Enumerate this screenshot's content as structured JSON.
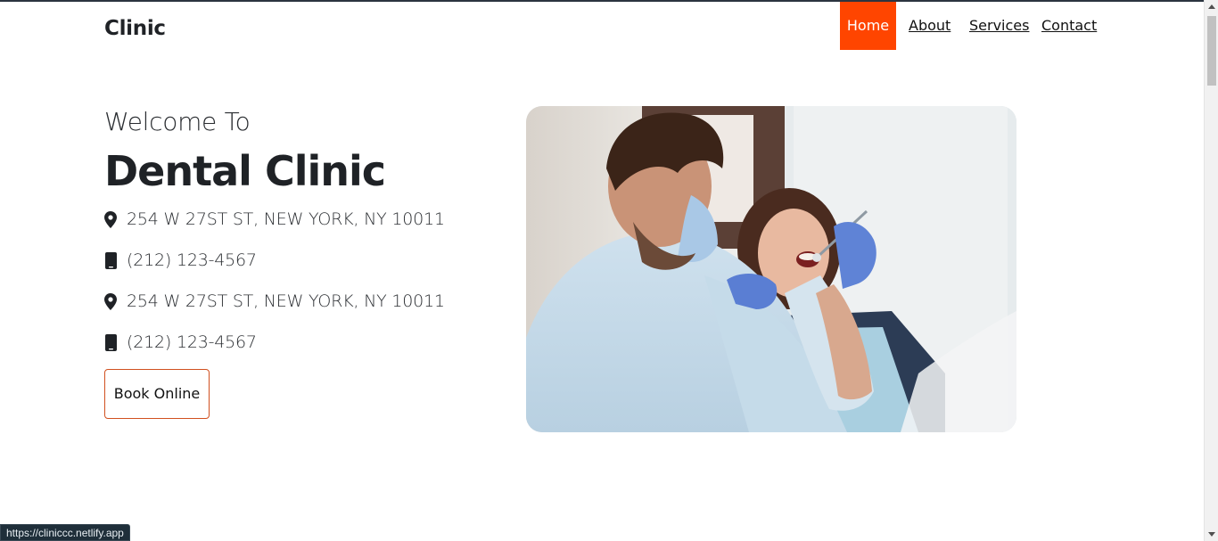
{
  "brand": "Clinic",
  "nav": {
    "items": [
      {
        "label": "Home",
        "active": true
      },
      {
        "label": "About",
        "active": false
      },
      {
        "label": "Services",
        "active": false
      },
      {
        "label": "Contact",
        "active": false
      }
    ]
  },
  "hero": {
    "welcome": "Welcome To",
    "title": "Dental Clinic",
    "info": [
      {
        "icon": "map-pin-icon",
        "text": "254 W 27ST ST, NEW YORK, NY 10011"
      },
      {
        "icon": "mobile-phone-icon",
        "text": "(212) 123-4567"
      },
      {
        "icon": "map-pin-icon",
        "text": "254 W 27ST ST, NEW YORK, NY 10011"
      },
      {
        "icon": "mobile-phone-icon",
        "text": "(212) 123-4567"
      }
    ],
    "book_button": "Book Online",
    "image_icon": "dentist-patient-photo"
  },
  "status_bar": {
    "url": "https://cliniccc.netlify.app"
  },
  "colors": {
    "accent": "#ff4500",
    "button_border": "#d1501f",
    "text_dark": "#1f2226"
  }
}
